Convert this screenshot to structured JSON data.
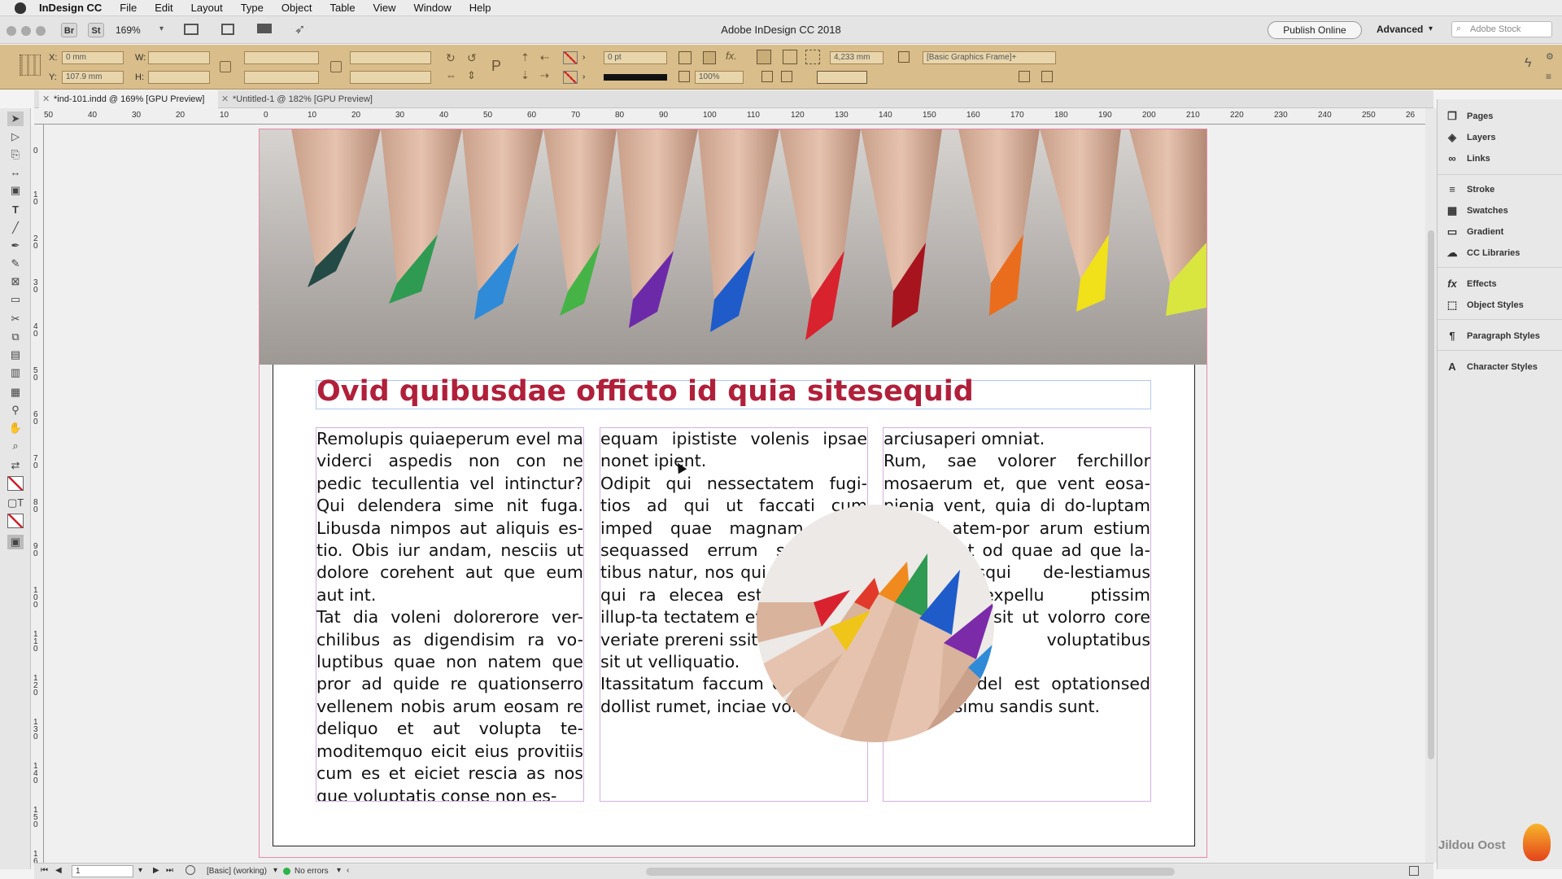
{
  "menubar": {
    "app": "InDesign CC",
    "items": [
      "File",
      "Edit",
      "Layout",
      "Type",
      "Object",
      "Table",
      "View",
      "Window",
      "Help"
    ]
  },
  "appbar": {
    "title": "Adobe InDesign CC 2018",
    "bridge": "Br",
    "stock_btn": "St",
    "zoom": "169%",
    "publish": "Publish Online",
    "workspace": "Advanced",
    "stock_search_placeholder": "Adobe Stock"
  },
  "control": {
    "x_label": "X:",
    "y_label": "Y:",
    "w_label": "W:",
    "h_label": "H:",
    "x_value": "0 mm",
    "y_value": "107.9 mm",
    "stroke_weight": "0 pt",
    "opacity": "100%",
    "offset": "4,233 mm",
    "object_style": "[Basic Graphics Frame]+"
  },
  "tabs": [
    {
      "label": "*ind-101.indd @ 169% [GPU Preview]"
    },
    {
      "label": "*Untitled-1 @ 182% [GPU Preview]"
    }
  ],
  "rulers": {
    "h_ticks": [
      "50",
      "40",
      "30",
      "20",
      "10",
      "0",
      "10",
      "20",
      "30",
      "40",
      "50",
      "60",
      "70",
      "80",
      "90",
      "100",
      "110",
      "120",
      "130",
      "140",
      "150",
      "160",
      "170",
      "180",
      "190",
      "200",
      "210",
      "220",
      "230",
      "240",
      "250",
      "26"
    ],
    "v_ticks": [
      "0",
      "1 0",
      "2 0",
      "3 0",
      "4 0",
      "5 0",
      "6 0",
      "7 0",
      "8 0",
      "9 0",
      "1 0 0",
      "1 1 0",
      "1 2 0",
      "1 3 0",
      "1 4 0",
      "1 5 0",
      "1 6"
    ]
  },
  "document": {
    "headline": "Ovid quibusdae officto id quia sitesequid",
    "col1": [
      "Remolupis quiaeperum evel ma viderci aspedis non con ne pedic tecullentia vel intinctur? Qui delendera sime nit fuga. Libusda nimpos aut aliquis es-tio. Obis iur andam, nesciis ut dolore corehent aut que eum aut int.",
      "Tat dia voleni dolorerore ver-chilibus as digendisim ra vo-luptibus quae non natem que pror ad quide re quationserro vellenem nobis arum eosam re deliquo et aut volupta te-moditemquo eicit eius provitiis cum es et eiciet rescia as nos que voluptatis conse non es-"
    ],
    "col2": [
      "equam ipististe volenis ipsae nonet ipient.",
      "Odipit qui nessectatem fugi-tios ad qui ut faccati cum imped quae magnam eaqui sequassed errum sam fugi-tibus natur, nos qui tem conse-qui ra elecea est, temporem illup-ta tectatem et et renis que veriate prereni ssitiur sequo cor sit ut velliquatio.",
      "Itassitatum faccum corro il ma dollist rumet, inciae volessint"
    ],
    "col3": [
      "arciusaperi omniat.",
      "Rum, sae volorer ferchillor mosaerum et, que vent eosa-pienia vent, quia di do-luptam experit atem-por arum estium quatur aut od quae ad que la-tur? Quisqui de-lestiamus alignis expellu ptissim usdaeceatia sit ut volorro core non-sequam voluptatibus doluptur?",
      "Voluptaes del est optationsed ut ut quisimu sandis sunt."
    ]
  },
  "panels": [
    {
      "label": "Pages",
      "icon": "pages-icon"
    },
    {
      "label": "Layers",
      "icon": "layers-icon"
    },
    {
      "label": "Links",
      "icon": "links-icon"
    },
    {
      "label": "Stroke",
      "icon": "stroke-icon"
    },
    {
      "label": "Swatches",
      "icon": "swatches-icon"
    },
    {
      "label": "Gradient",
      "icon": "gradient-icon"
    },
    {
      "label": "CC Libraries",
      "icon": "cc-libraries-icon"
    },
    {
      "label": "Effects",
      "icon": "effects-icon"
    },
    {
      "label": "Object Styles",
      "icon": "object-styles-icon"
    },
    {
      "label": "Paragraph Styles",
      "icon": "paragraph-styles-icon"
    },
    {
      "label": "Character Styles",
      "icon": "character-styles-icon"
    }
  ],
  "status": {
    "page": "1",
    "profile": "[Basic] (working)",
    "preflight": "No errors"
  },
  "watermark": "Jildou Oost",
  "colors": {
    "headline": "#b0203a",
    "control_bar": "#d9bd8a",
    "bleed": "#e58aa7"
  }
}
